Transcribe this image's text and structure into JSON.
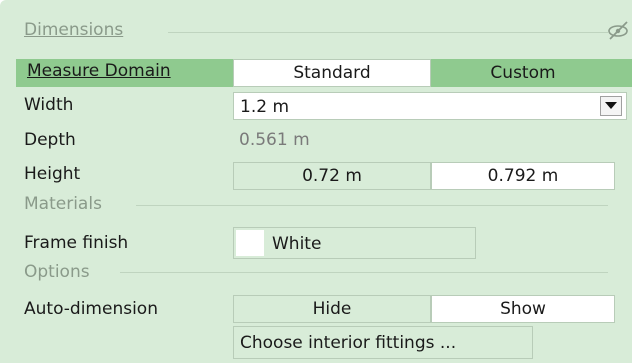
{
  "sections": {
    "dimensions": "Dimensions",
    "materials": "Materials",
    "options": "Options"
  },
  "measure_domain": {
    "label": "Measure Domain",
    "options": [
      "Standard",
      "Custom"
    ],
    "selected": "Custom"
  },
  "width": {
    "label": "Width",
    "value": "1.2 m"
  },
  "depth": {
    "label": "Depth",
    "value": "0.561 m"
  },
  "height": {
    "label": "Height",
    "standard_value": "0.72 m",
    "custom_value": "0.792 m"
  },
  "frame_finish": {
    "label": "Frame finish",
    "value": "White",
    "swatch_color": "#ffffff"
  },
  "auto_dimension": {
    "label": "Auto-dimension",
    "options": [
      "Hide",
      "Show"
    ],
    "selected": "Show"
  },
  "interior_button": {
    "label": "Choose interior fittings ..."
  },
  "colors": {
    "panel_bg": "#d8ecd8",
    "highlight": "#8fca8f",
    "muted_text": "#8a9a8a"
  },
  "icons": {
    "visibility": "eye-slash-icon",
    "dropdown": "triangle-down-icon"
  }
}
